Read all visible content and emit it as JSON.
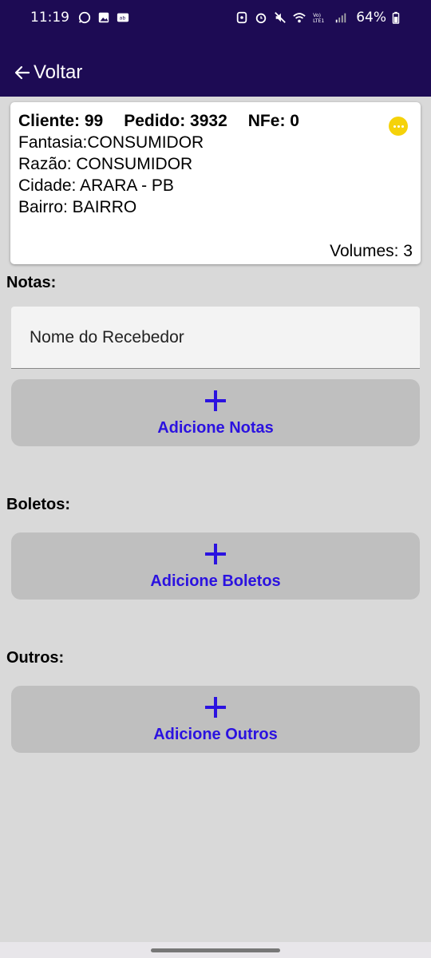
{
  "status_bar": {
    "time": "11:19",
    "battery": "64%",
    "left_icons": [
      "whatsapp-icon",
      "gallery-icon",
      "notification-icon"
    ],
    "right_icons": [
      "data-saver-icon",
      "alarm-icon",
      "mute-icon",
      "wifi-icon",
      "volte-icon",
      "signal-icon",
      "battery-icon"
    ],
    "network_label": "Vo) LTE1"
  },
  "app_bar": {
    "back_label": "Voltar",
    "background": "#1d0b54"
  },
  "card": {
    "cliente": "Cliente: 99",
    "pedido": "Pedido: 3932",
    "nfe": "NFe: 0",
    "fantasia": "Fantasia:CONSUMIDOR",
    "razao": "Razão: CONSUMIDOR",
    "cidade": "Cidade: ARARA - PB",
    "bairro": "Bairro: BAIRRO",
    "volumes": "Volumes: 3",
    "more_icon": "more-horizontal-icon",
    "more_color": "#f5d20a"
  },
  "notas": {
    "label": "Notas:",
    "receiver_placeholder": "Nome do Recebedor",
    "add_label": "Adicione Notas"
  },
  "boletos": {
    "label": "Boletos:",
    "add_label": "Adicione Boletos"
  },
  "outros": {
    "label": "Outros:",
    "add_label": "Adicione Outros"
  },
  "colors": {
    "accent": "#2b12e0",
    "page_background": "#d9d9d9",
    "button_background": "#bfbfbf"
  }
}
